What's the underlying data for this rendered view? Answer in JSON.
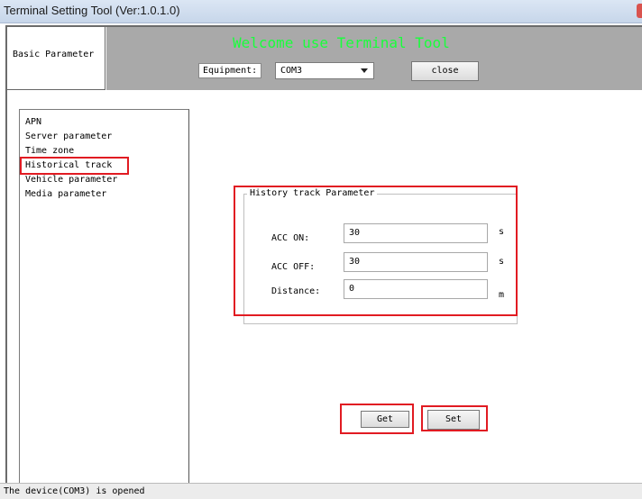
{
  "window": {
    "title": "Terminal Setting Tool  (Ver:1.0.1.0)"
  },
  "header": {
    "basic_parameter_label": "Basic Parameter",
    "welcome_text": "Welcome use Terminal Tool",
    "equipment_label": "Equipment:",
    "equipment_value": "COM3",
    "close_button": "close"
  },
  "sidebar": {
    "items": [
      {
        "label": "APN"
      },
      {
        "label": "Server parameter"
      },
      {
        "label": "Time zone"
      },
      {
        "label": "Historical track",
        "highlighted": true
      },
      {
        "label": "Vehicle parameter"
      },
      {
        "label": "Media parameter"
      }
    ]
  },
  "history_track": {
    "group_title": "History track Parameter",
    "fields": [
      {
        "label": "ACC ON:",
        "value": "30",
        "unit": "s"
      },
      {
        "label": "ACC OFF:",
        "value": "30",
        "unit": "s"
      },
      {
        "label": "Distance:",
        "value": "0",
        "unit": "m"
      }
    ]
  },
  "actions": {
    "get_label": "Get",
    "set_label": "Set"
  },
  "status_bar": {
    "text": "The device(COM3) is opened"
  },
  "colors": {
    "welcome_text": "#19ff3b",
    "highlight_box": "#e11b22",
    "header_bg": "#a9a9a9"
  }
}
